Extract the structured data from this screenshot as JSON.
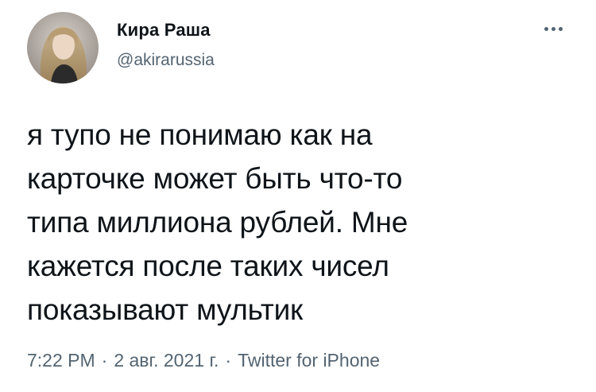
{
  "author": {
    "display_name": "Кира Раша",
    "handle": "@akirarussia"
  },
  "tweet": {
    "lines": [
      "я тупо не понимаю как на",
      "карточке может быть что-то",
      "типа миллиона рублей. Мне",
      "кажется после таких чисел",
      "показывают мультик"
    ]
  },
  "meta": {
    "time": "7:22 PM",
    "separator": "·",
    "date": "2 авг. 2021 г.",
    "source": "Twitter for iPhone"
  },
  "icons": {
    "more": "more-options-icon",
    "avatar": "avatar"
  },
  "colors": {
    "text": "#0f1419",
    "secondary": "#536471",
    "background": "#ffffff"
  }
}
